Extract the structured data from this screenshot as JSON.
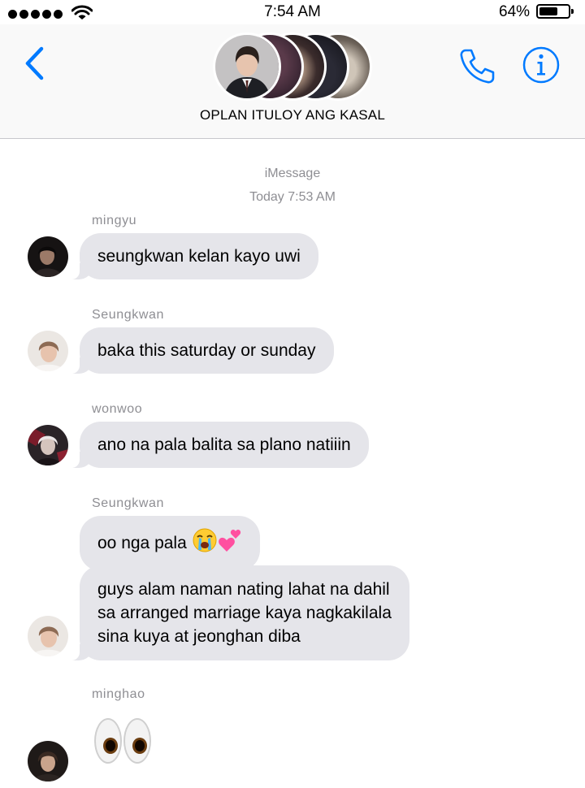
{
  "status_bar": {
    "time": "7:54 AM",
    "battery_percent": "64%",
    "battery_level": 0.64,
    "icons": [
      "signal-dots-icon",
      "wifi-icon",
      "battery-icon"
    ]
  },
  "header": {
    "back_icon": "chevron-left-icon",
    "group_name": "OPLAN ITULOY ANG KASAL",
    "call_icon": "phone-icon",
    "info_icon": "info-icon"
  },
  "conversation": {
    "service": "iMessage",
    "timestamp": "Today 7:53 AM",
    "blocks": [
      {
        "sender": "mingyu",
        "messages": [
          "seungkwan kelan kayo uwi"
        ]
      },
      {
        "sender": "Seungkwan",
        "messages": [
          "baka this saturday or sunday"
        ]
      },
      {
        "sender": "wonwoo",
        "messages": [
          "ano na pala balita sa plano natiiin"
        ]
      },
      {
        "sender": "Seungkwan",
        "messages": [
          "oo nga pala",
          [
            "guys alam naman nating lahat na dahil",
            "sa arranged marriage kaya nagkakilala",
            "sina kuya at jeonghan diba"
          ]
        ]
      },
      {
        "sender": "minghao",
        "messages": [
          "eyes-emoji"
        ]
      }
    ]
  },
  "colors": {
    "accent": "#007aff",
    "bubble": "#e5e5ea",
    "meta_text": "#8e8e93",
    "header_bg": "#f9f9f9"
  }
}
